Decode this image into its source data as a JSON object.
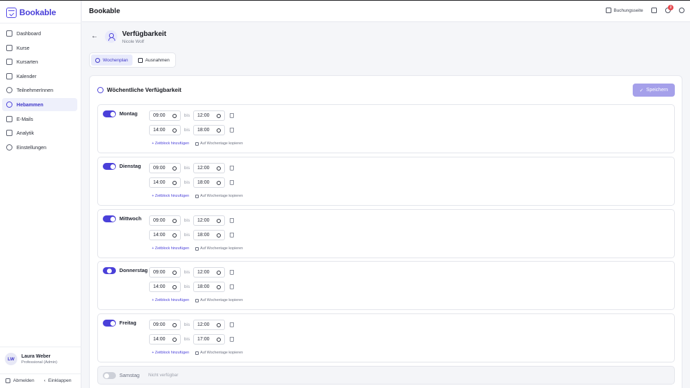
{
  "brand": {
    "name": "Bookable",
    "accent": "#4a40d9"
  },
  "sidebar": {
    "items": [
      {
        "label": "Dashboard",
        "icon": "grid-icon",
        "active": false
      },
      {
        "label": "Kurse",
        "icon": "book-icon",
        "active": false
      },
      {
        "label": "Kursarten",
        "icon": "tag-icon",
        "active": false
      },
      {
        "label": "Kalender",
        "icon": "calendar-icon",
        "active": false
      },
      {
        "label": "TeilnehmerInnen",
        "icon": "users-icon",
        "active": false
      },
      {
        "label": "Hebammen",
        "icon": "user-group-icon",
        "active": true
      },
      {
        "label": "E-Mails",
        "icon": "mail-icon",
        "active": false
      },
      {
        "label": "Analytik",
        "icon": "chart-icon",
        "active": false
      },
      {
        "label": "Einstellungen",
        "icon": "gear-icon",
        "active": false
      }
    ],
    "user": {
      "initials": "LW",
      "name": "Laura Weber",
      "role": "Professional (Admin)"
    },
    "logout_label": "Abmelden",
    "collapse_label": "Einklappen"
  },
  "header": {
    "title": "Bookable",
    "booking_link": "Buchungsseite",
    "notification_count": "1"
  },
  "page": {
    "title": "Verfügbarkeit",
    "subtitle": "Nicole Wolf",
    "tabs": [
      {
        "label": "Wochenplan",
        "active": true
      },
      {
        "label": "Ausnahmen",
        "active": false
      }
    ]
  },
  "card": {
    "title": "Wöchentliche Verfügbarkeit",
    "save_label": "Speichern",
    "bis": "bis",
    "add_label": "+ Zeitblock hinzufügen",
    "copy_label": "Auf Wochentage kopieren",
    "unavailable_label": "Nicht verfügbar",
    "days": [
      {
        "name": "Montag",
        "slots": [
          {
            "from": "09:00",
            "to": "12:00"
          },
          {
            "from": "14:00",
            "to": "18:00"
          }
        ]
      },
      {
        "name": "Dienstag",
        "slots": [
          {
            "from": "09:00",
            "to": "12:00"
          },
          {
            "from": "14:00",
            "to": "18:00"
          }
        ]
      },
      {
        "name": "Mittwoch",
        "slots": [
          {
            "from": "09:00",
            "to": "12:00"
          },
          {
            "from": "14:00",
            "to": "18:00"
          }
        ]
      },
      {
        "name": "Donnerstag",
        "slots": [
          {
            "from": "09:00",
            "to": "12:00"
          },
          {
            "from": "14:00",
            "to": "18:00"
          }
        ]
      },
      {
        "name": "Freitag",
        "slots": [
          {
            "from": "09:00",
            "to": "12:00"
          },
          {
            "from": "14:00",
            "to": "17:00"
          }
        ]
      },
      {
        "name": "Samstag",
        "slots": []
      }
    ]
  }
}
